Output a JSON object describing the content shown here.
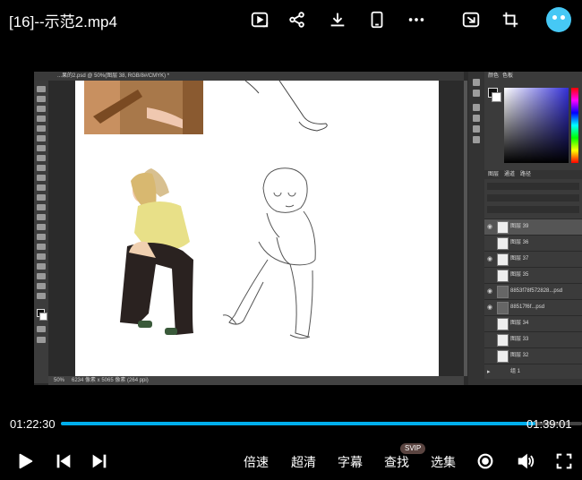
{
  "header": {
    "title": "[16]--示范2.mp4",
    "icons": [
      "picture-in-picture-icon",
      "share-icon",
      "download-icon",
      "phone-icon",
      "more-icon",
      "cast-icon",
      "crop-icon",
      "avatar"
    ]
  },
  "ps": {
    "tab_title": "...果的2.psd @ 50%(图层 38, RGB/8#/CMYK) *",
    "status": "50%",
    "status_doc": "6234 像素 x 5065 像素 (264 ppi)",
    "panel_tabs": [
      "颜色",
      "色板"
    ],
    "layers_tabs": [
      "图层",
      "通道",
      "路径"
    ],
    "layers": [
      {
        "name": "图层 39"
      },
      {
        "name": "图层 36"
      },
      {
        "name": "图层 37"
      },
      {
        "name": "图层 35"
      },
      {
        "name": "8853f78f572828...psd"
      },
      {
        "name": "88517f6f...psd"
      },
      {
        "name": "图层 34"
      },
      {
        "name": "图层 33"
      },
      {
        "name": "图层 32"
      },
      {
        "name": "组 1"
      }
    ]
  },
  "player": {
    "current_time": "01:22:30",
    "end_time": "01:39:01",
    "progress": 0.91,
    "speed_label": "倍速",
    "quality_label": "超清",
    "subtitle_label": "字幕",
    "search_label": "查找",
    "search_badge": "SVIP",
    "episodes_label": "选集"
  },
  "colors": {
    "accent": "#00aeec",
    "background": "#000000"
  }
}
